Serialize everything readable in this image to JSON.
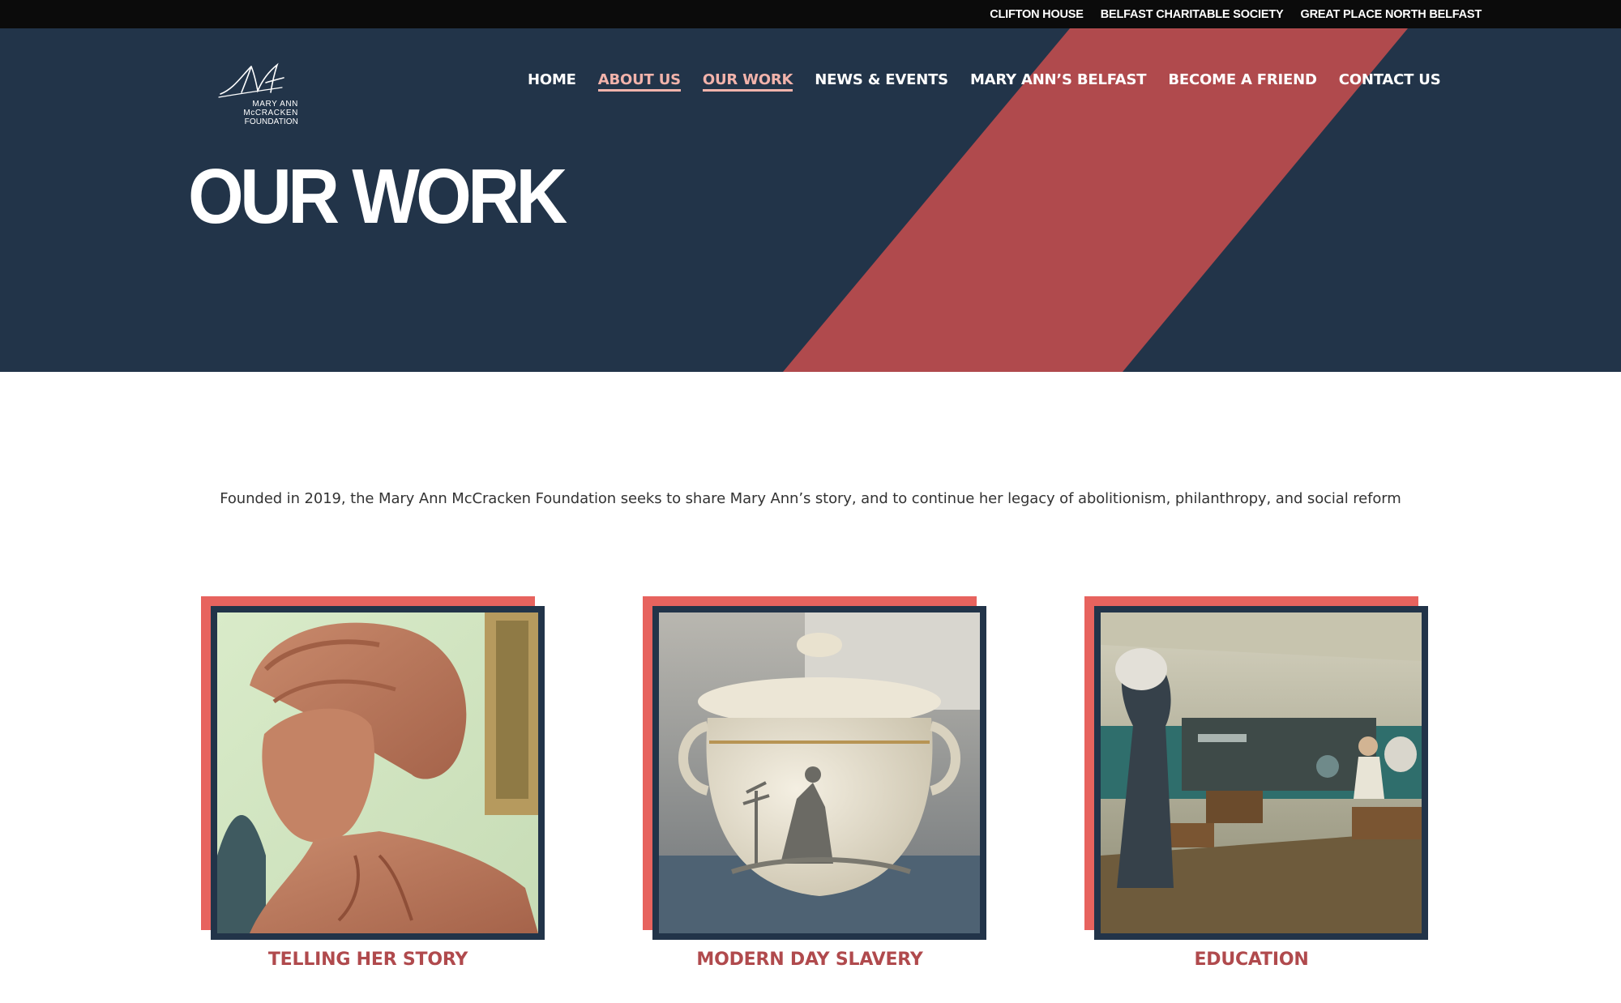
{
  "topbar": {
    "links": [
      "CLIFTON HOUSE",
      "BELFAST CHARITABLE SOCIETY",
      "GREAT PLACE NORTH BELFAST"
    ]
  },
  "logo": {
    "lines": [
      "MARY ANN",
      "McCRACKEN",
      "FOUNDATION"
    ]
  },
  "nav": {
    "items": [
      {
        "label": "HOME",
        "active": false
      },
      {
        "label": "ABOUT US",
        "active": true
      },
      {
        "label": "OUR WORK",
        "active": true
      },
      {
        "label": "NEWS & EVENTS",
        "active": false
      },
      {
        "label": "MARY ANN’S BELFAST",
        "active": false
      },
      {
        "label": "BECOME A FRIEND",
        "active": false
      },
      {
        "label": "CONTACT US",
        "active": false
      }
    ]
  },
  "hero": {
    "title": "OUR WORK"
  },
  "intro": {
    "text": "Founded in 2019, the Mary Ann McCracken Foundation seeks to share Mary Ann’s story, and to continue her legacy of abolitionism, philanthropy, and social reform"
  },
  "cards": [
    {
      "label": "TELLING HER STORY",
      "image": "terracotta-bust-photo"
    },
    {
      "label": "MODERN DAY SLAVERY",
      "image": "sugar-bowl-photo"
    },
    {
      "label": "EDUCATION",
      "image": "classroom-scene-photo"
    }
  ],
  "colors": {
    "navy": "#223449",
    "coral": "#e7635e",
    "stripe": "#b04a4d",
    "active_nav": "#f2b3ab",
    "topbar": "#0b0b0b"
  }
}
